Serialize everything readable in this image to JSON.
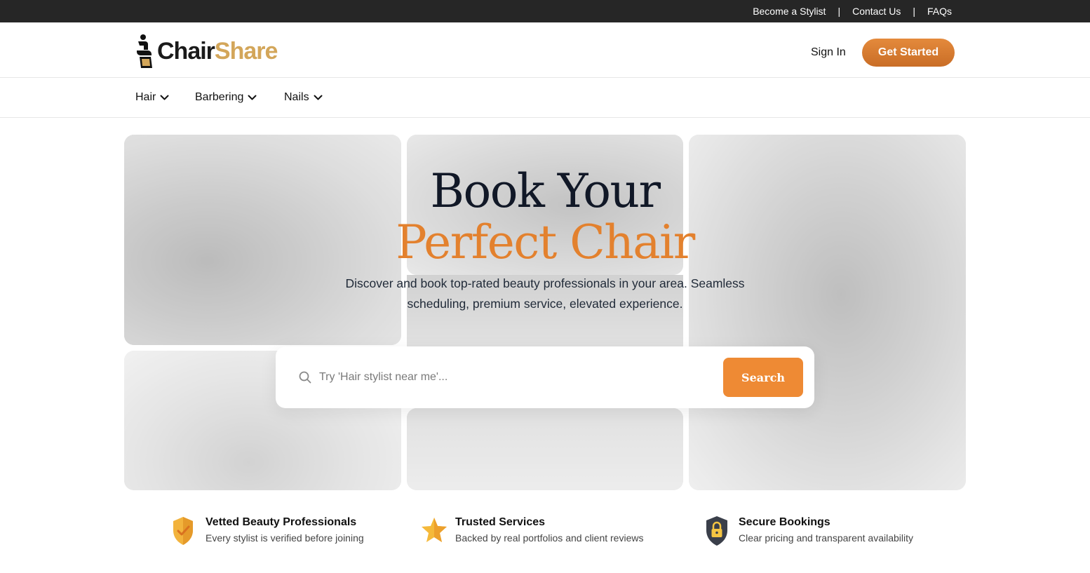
{
  "topbar": {
    "links": [
      "Become a Stylist",
      "Contact Us",
      "FAQs"
    ],
    "separator": "|"
  },
  "header": {
    "logo_part1": "Chair",
    "logo_part2": "Share",
    "signin_label": "Sign In",
    "cta_label": "Get Started"
  },
  "categories": [
    "Hair",
    "Barbering",
    "Nails"
  ],
  "hero": {
    "title_line1": "Book Your",
    "title_line2": "Perfect Chair",
    "subtitle_line1": "Discover and book top-rated beauty professionals in your area. Seamless",
    "subtitle_line2": "scheduling, premium service, elevated experience."
  },
  "search": {
    "placeholder": "Try 'Hair stylist near me'...",
    "button_label": "Search"
  },
  "features": [
    {
      "icon": "shield-check-icon",
      "title": "Vetted Beauty Professionals",
      "desc": "Every stylist is verified before joining"
    },
    {
      "icon": "star-icon",
      "title": "Trusted Services",
      "desc": "Backed by real portfolios and client reviews"
    },
    {
      "icon": "lock-shield-icon",
      "title": "Secure Bookings",
      "desc": "Clear pricing and transparent availability"
    }
  ],
  "colors": {
    "accent": "#e3812e",
    "logo_gold": "#d3a65a",
    "topbar": "#262626"
  }
}
